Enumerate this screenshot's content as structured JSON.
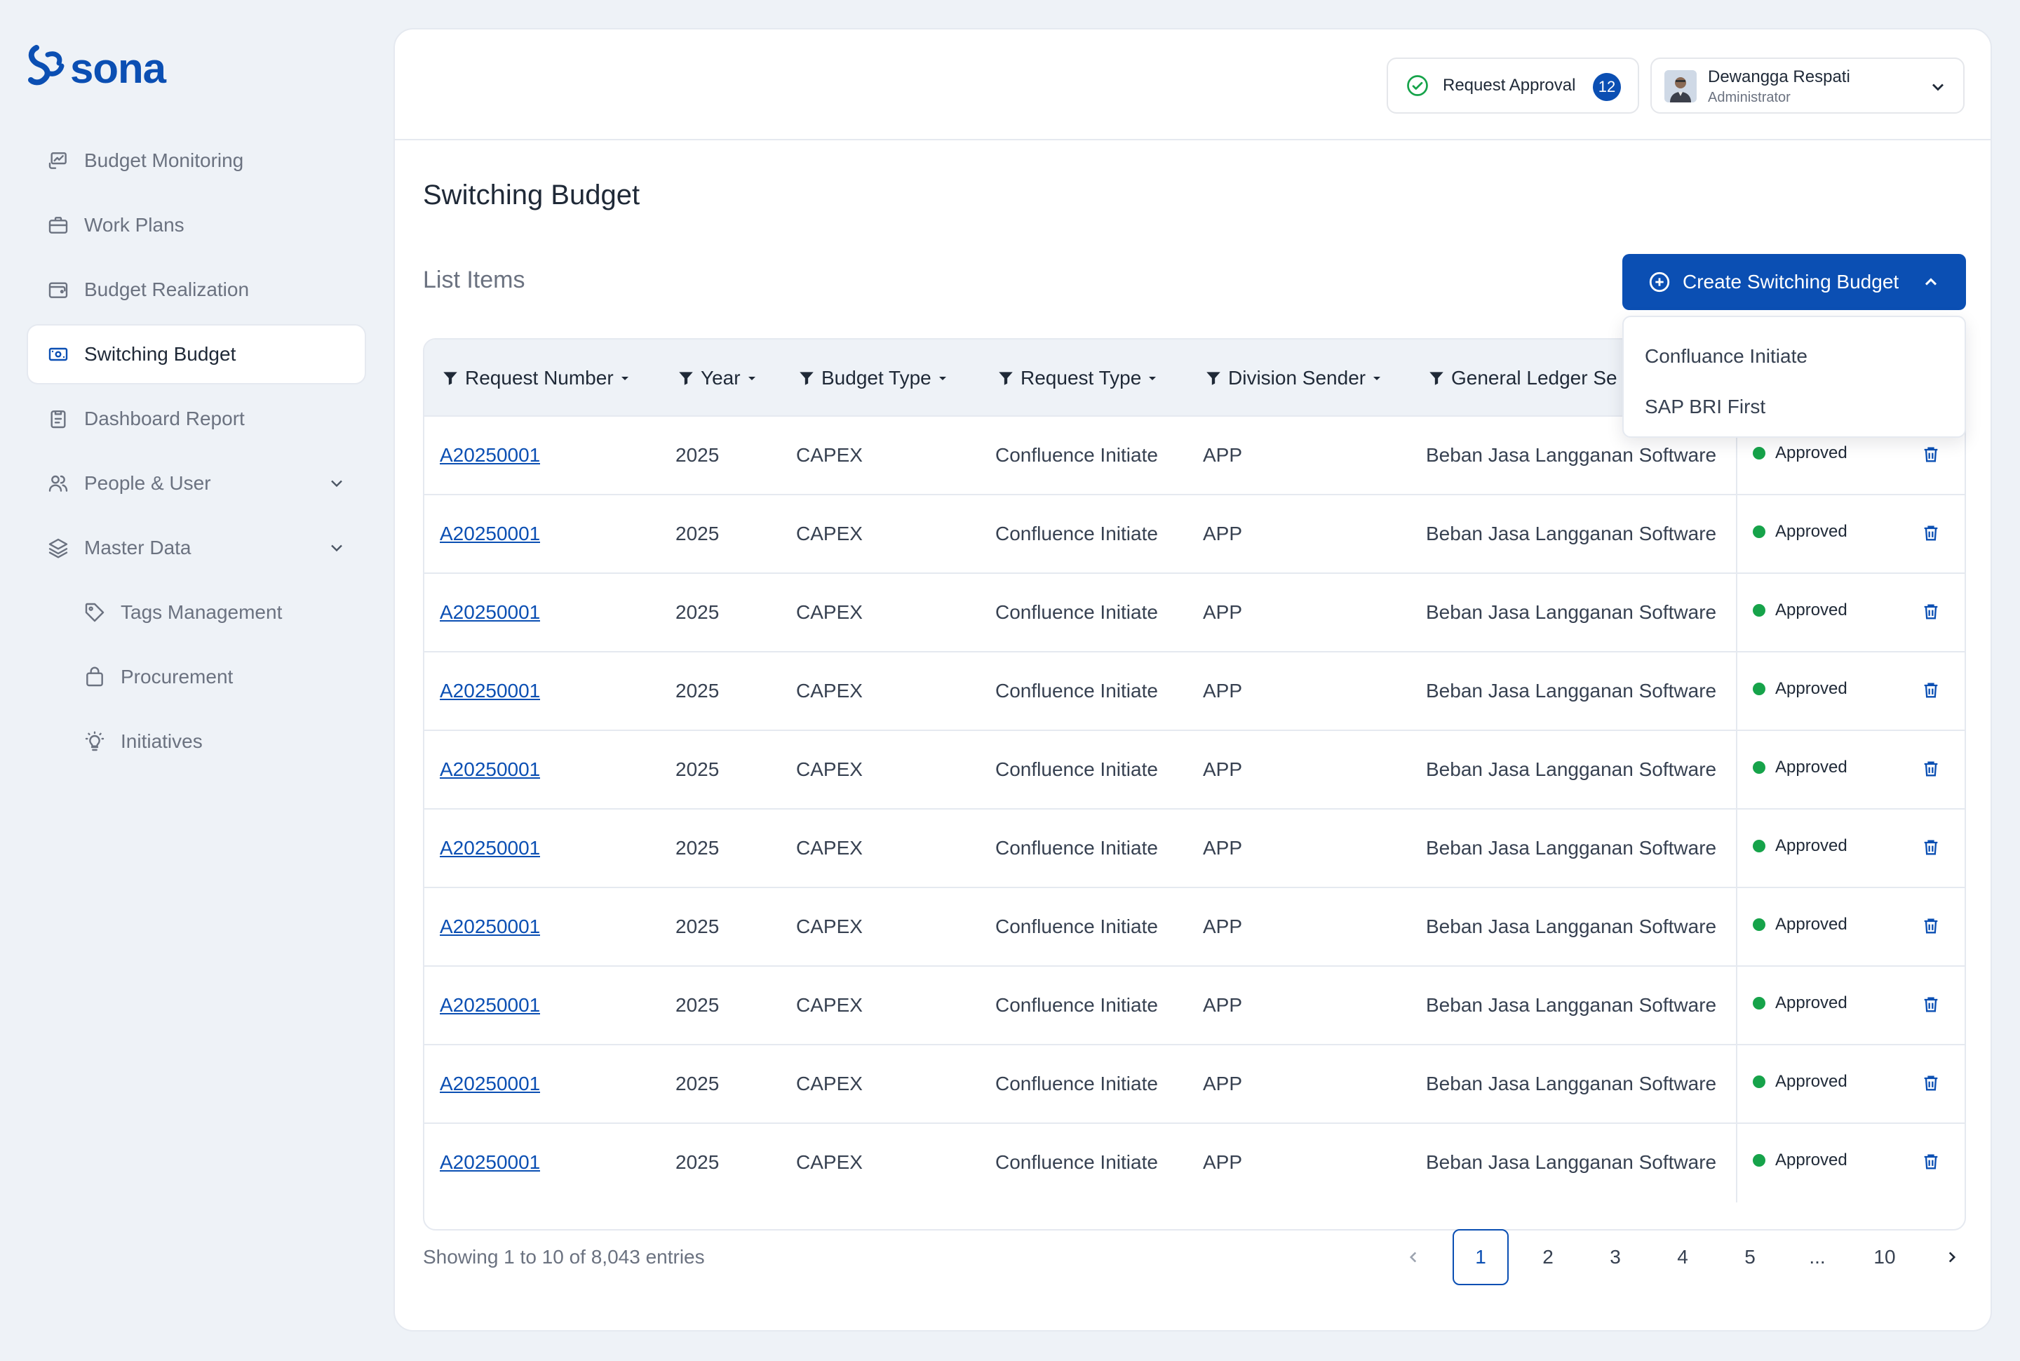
{
  "brand": {
    "name": "sona",
    "color": "#0b4fb3"
  },
  "sidebar": {
    "items": [
      {
        "label": "Budget Monitoring",
        "icon": "monitor-chart-icon"
      },
      {
        "label": "Work Plans",
        "icon": "briefcase-icon"
      },
      {
        "label": "Budget Realization",
        "icon": "wallet-icon"
      },
      {
        "label": "Switching Budget",
        "icon": "money-switch-icon",
        "active": true
      },
      {
        "label": "Dashboard Report",
        "icon": "clipboard-icon"
      },
      {
        "label": "People & User",
        "icon": "users-icon",
        "expandable": true
      },
      {
        "label": "Master Data",
        "icon": "layers-icon",
        "expandable": true
      },
      {
        "label": "Tags Management",
        "icon": "tag-icon"
      },
      {
        "label": "Procurement",
        "icon": "shopping-bag-icon"
      },
      {
        "label": "Initiatives",
        "icon": "lightbulb-icon"
      }
    ]
  },
  "header": {
    "approval_label": "Request Approval",
    "approval_count": "12",
    "user_name": "Dewangga Respati",
    "user_role": "Administrator"
  },
  "page": {
    "title": "Switching Budget",
    "list_title": "List Items",
    "create_label": "Create Switching Budget",
    "create_menu": [
      "Confluance Initiate",
      "SAP BRI First"
    ]
  },
  "table": {
    "columns": [
      "Request Number",
      "Year",
      "Budget Type",
      "Request Type",
      "Division Sender",
      "General Ledger Se"
    ],
    "rows": [
      [
        "A20250001",
        "2025",
        "CAPEX",
        "Confluence Initiate",
        "APP",
        "Beban Jasa Langganan Software",
        "Approved"
      ],
      [
        "A20250001",
        "2025",
        "CAPEX",
        "Confluence Initiate",
        "APP",
        "Beban Jasa Langganan Software",
        "Approved"
      ],
      [
        "A20250001",
        "2025",
        "CAPEX",
        "Confluence Initiate",
        "APP",
        "Beban Jasa Langganan Software",
        "Approved"
      ],
      [
        "A20250001",
        "2025",
        "CAPEX",
        "Confluence Initiate",
        "APP",
        "Beban Jasa Langganan Software",
        "Approved"
      ],
      [
        "A20250001",
        "2025",
        "CAPEX",
        "Confluence Initiate",
        "APP",
        "Beban Jasa Langganan Software",
        "Approved"
      ],
      [
        "A20250001",
        "2025",
        "CAPEX",
        "Confluence Initiate",
        "APP",
        "Beban Jasa Langganan Software",
        "Approved"
      ],
      [
        "A20250001",
        "2025",
        "CAPEX",
        "Confluence Initiate",
        "APP",
        "Beban Jasa Langganan Software",
        "Approved"
      ],
      [
        "A20250001",
        "2025",
        "CAPEX",
        "Confluence Initiate",
        "APP",
        "Beban Jasa Langganan Software",
        "Approved"
      ],
      [
        "A20250001",
        "2025",
        "CAPEX",
        "Confluence Initiate",
        "APP",
        "Beban Jasa Langganan Software",
        "Approved"
      ],
      [
        "A20250001",
        "2025",
        "CAPEX",
        "Confluence Initiate",
        "APP",
        "Beban Jasa Langganan Software",
        "Approved"
      ]
    ],
    "status_color": "#16a34a"
  },
  "footer": {
    "showing": "Showing 1 to 10 of 8,043 entries",
    "pages": [
      "1",
      "2",
      "3",
      "4",
      "5",
      "...",
      "10"
    ],
    "current_page": "1"
  }
}
